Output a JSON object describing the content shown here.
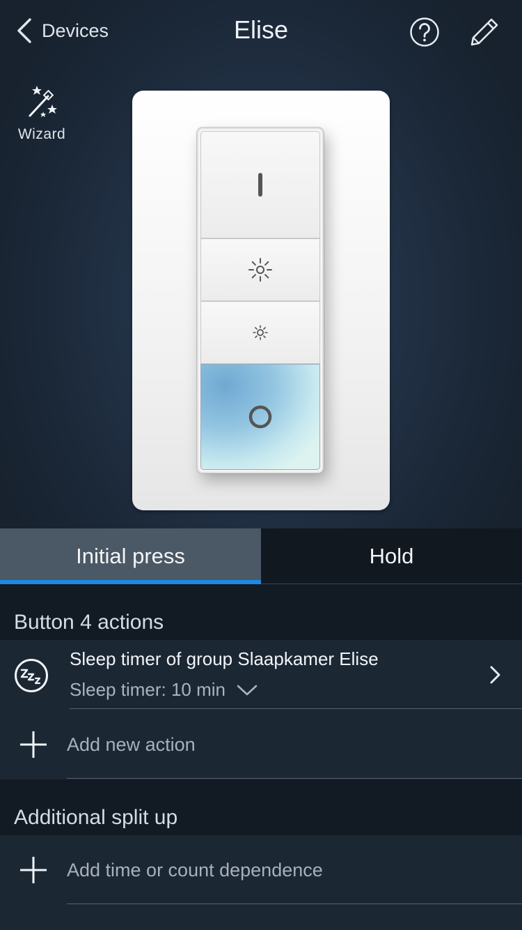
{
  "header": {
    "back_label": "Devices",
    "title": "Elise"
  },
  "wizard": {
    "label": "Wizard"
  },
  "tabs": [
    {
      "label": "Initial press",
      "active": true
    },
    {
      "label": "Hold",
      "active": false
    }
  ],
  "button_actions": {
    "section_title": "Button 4 actions",
    "items": [
      {
        "title": "Sleep timer of group Slaapkamer Elise",
        "subtitle": "Sleep timer: 10 min",
        "icon": "sleep-zzz-icon"
      }
    ],
    "add_label": "Add new action"
  },
  "split_up": {
    "section_title": "Additional split up",
    "add_label": "Add time or count dependence"
  },
  "colors": {
    "accent": "#1e88e5",
    "background": "#16202c",
    "active_tab": "#4b5866"
  }
}
